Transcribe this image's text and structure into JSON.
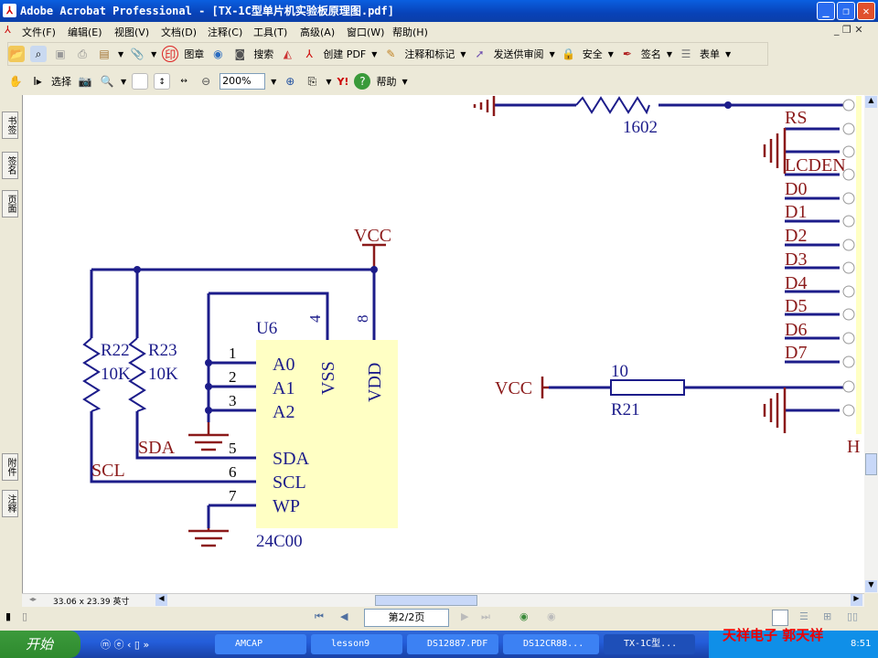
{
  "window": {
    "title": "Adobe Acrobat Professional - [TX-1C型单片机实验板原理图.pdf]"
  },
  "menu": [
    "文件(F)",
    "编辑(E)",
    "视图(V)",
    "文档(D)",
    "注释(C)",
    "工具(T)",
    "高级(A)",
    "窗口(W)",
    "帮助(H)"
  ],
  "toolbar1": {
    "stamp": "图章",
    "search": "搜索",
    "create_pdf": "创建 PDF",
    "comment": "注释和标记",
    "review": "发送供审阅",
    "security": "安全",
    "sign": "签名",
    "forms": "表单"
  },
  "toolbar2": {
    "select": "选择",
    "zoom": "200%",
    "help": "帮助"
  },
  "left_tabs": [
    "书签",
    "签名",
    "页面",
    "附件",
    "注释"
  ],
  "schematic": {
    "r_top": "1602",
    "connector": [
      "RS",
      "LCDEN",
      "D0",
      "D1",
      "D2",
      "D3",
      "D4",
      "D5",
      "D6",
      "D7"
    ],
    "connector_h": "H",
    "vcc1": "VCC",
    "vcc2": "VCC",
    "r22": "R22",
    "r22v": "10K",
    "r23": "R23",
    "r23v": "10K",
    "sda": "SDA",
    "scl": "SCL",
    "u6": "U6",
    "part": "24C00",
    "pins_left": [
      "A0",
      "A1",
      "A2",
      "SDA",
      "SCL",
      "WP"
    ],
    "pin_nums": [
      "1",
      "2",
      "3",
      "5",
      "6",
      "7"
    ],
    "vss": "VSS",
    "vdd": "VDD",
    "pin4": "4",
    "pin8": "8",
    "r21": "R21",
    "r21v": "10"
  },
  "status": {
    "page_size": "33.06 x 23.39 英寸",
    "page": "第2/2页"
  },
  "taskbar": {
    "start": "开始",
    "tasks": [
      "AMCAP",
      "lesson9",
      "DS12887.PDF",
      "DS12CR88...",
      "TX-1C型..."
    ],
    "watermark": "天祥电子 郭天祥",
    "clock": "8:51"
  },
  "colors": {
    "wire": "#1c1c8a",
    "label": "#8b1a1a",
    "chip": "#ffffc4"
  }
}
